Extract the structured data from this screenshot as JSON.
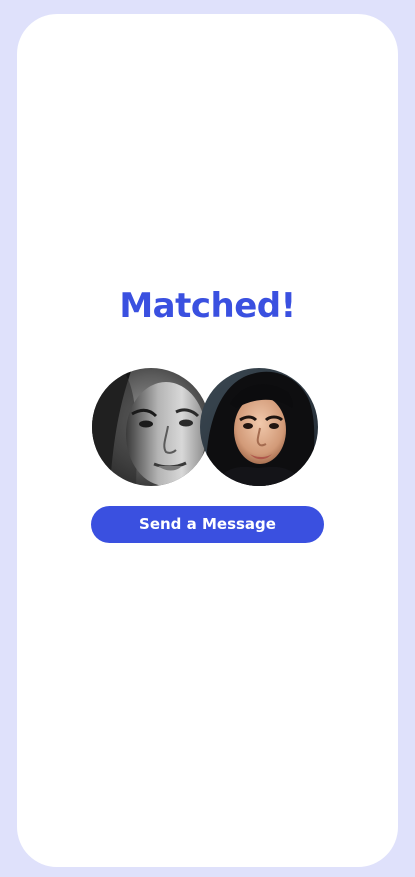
{
  "match_screen": {
    "title": "Matched!",
    "send_button_label": "Send a Message"
  },
  "colors": {
    "accent": "#3a50e0",
    "background": "#dfe1fb",
    "card": "#ffffff"
  },
  "avatars": [
    {
      "icon": "avatar-photo-grayscale-woman"
    },
    {
      "icon": "avatar-photo-dark-hair-woman"
    }
  ]
}
